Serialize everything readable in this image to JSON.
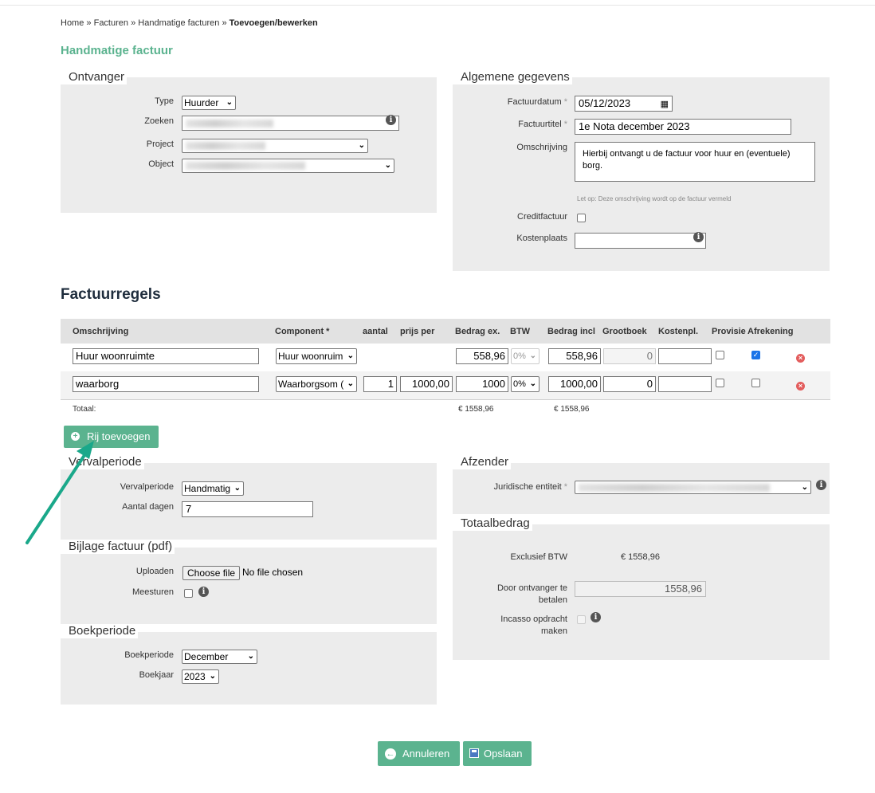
{
  "breadcrumb": {
    "home": "Home",
    "sep": "»",
    "facturen": "Facturen",
    "handmatige": "Handmatige facturen",
    "current": "Toevoegen/bewerken"
  },
  "page_title": "Handmatige factuur",
  "ontvanger": {
    "legend": "Ontvanger",
    "type_label": "Type",
    "type_value": "Huurder",
    "zoeken_label": "Zoeken",
    "project_label": "Project",
    "object_label": "Object"
  },
  "algemeen": {
    "legend": "Algemene gegevens",
    "factuurdatum_label": "Factuurdatum",
    "factuurdatum_value": "05/12/2023",
    "factuurtitel_label": "Factuurtitel",
    "factuurtitel_value": "1e Nota december 2023",
    "omschrijving_label": "Omschrijving",
    "omschrijving_value": "Hierbij ontvangt u de factuur voor huur en (eventuele) borg.",
    "omschrijving_hint": "Let op: Deze omschrijving wordt op de factuur vermeld",
    "creditfactuur_label": "Creditfactuur",
    "kostenplaats_label": "Kostenplaats",
    "required_mark": "*"
  },
  "factuurregels": {
    "heading": "Factuurregels",
    "columns": [
      "Omschrijving",
      "Component *",
      "aantal",
      "prijs per",
      "Bedrag ex.",
      "BTW",
      "Bedrag incl",
      "Grootboek",
      "Kostenpl.",
      "Provisie",
      "Afrekening"
    ],
    "rows": [
      {
        "omschrijving": "Huur woonruimte",
        "component": "Huur woonruim",
        "aantal": "",
        "prijs_per": "",
        "bedrag_ex": "558,96",
        "btw": "0%",
        "bedrag_incl": "558,96",
        "grootboek": "0",
        "kostenpl": "",
        "provisie": false,
        "afrekening": true
      },
      {
        "omschrijving": "waarborg",
        "component": "Waarborgsom (",
        "aantal": "1",
        "prijs_per": "1000,00",
        "bedrag_ex": "1000",
        "btw": "0%",
        "bedrag_incl": "1000,00",
        "grootboek": "0",
        "kostenpl": "",
        "provisie": false,
        "afrekening": false
      }
    ],
    "totaal_label": "Totaal:",
    "totaal_ex": "€ 1558,96",
    "totaal_incl": "€ 1558,96",
    "add_row_label": "Rij toevoegen"
  },
  "vervalperiode": {
    "legend": "Vervalperiode",
    "periode_label": "Vervalperiode",
    "periode_value": "Handmatig",
    "dagen_label": "Aantal dagen",
    "dagen_value": "7"
  },
  "bijlage": {
    "legend": "Bijlage factuur (pdf)",
    "uploaden_label": "Uploaden",
    "choose_file": "Choose file",
    "no_file": "No file chosen",
    "meesturen_label": "Meesturen"
  },
  "boekperiode": {
    "legend": "Boekperiode",
    "periode_label": "Boekperiode",
    "periode_value": "December",
    "jaar_label": "Boekjaar",
    "jaar_value": "2023"
  },
  "afzender": {
    "legend": "Afzender",
    "entiteit_label": "Juridische entiteit"
  },
  "totaalbedrag": {
    "legend": "Totaalbedrag",
    "excl_label": "Exclusief BTW",
    "excl_value": "€ 1558,96",
    "door_label_1": "Door ontvanger te",
    "door_label_2": "betalen",
    "door_value": "1558,96",
    "incasso_label_1": "Incasso opdracht",
    "incasso_label_2": "maken"
  },
  "footer": {
    "annuleren": "Annuleren",
    "opslaan": "Opslaan"
  },
  "colors": {
    "accent": "#5bb38f",
    "panel": "#ececec",
    "arrow": "#1aa88a"
  }
}
